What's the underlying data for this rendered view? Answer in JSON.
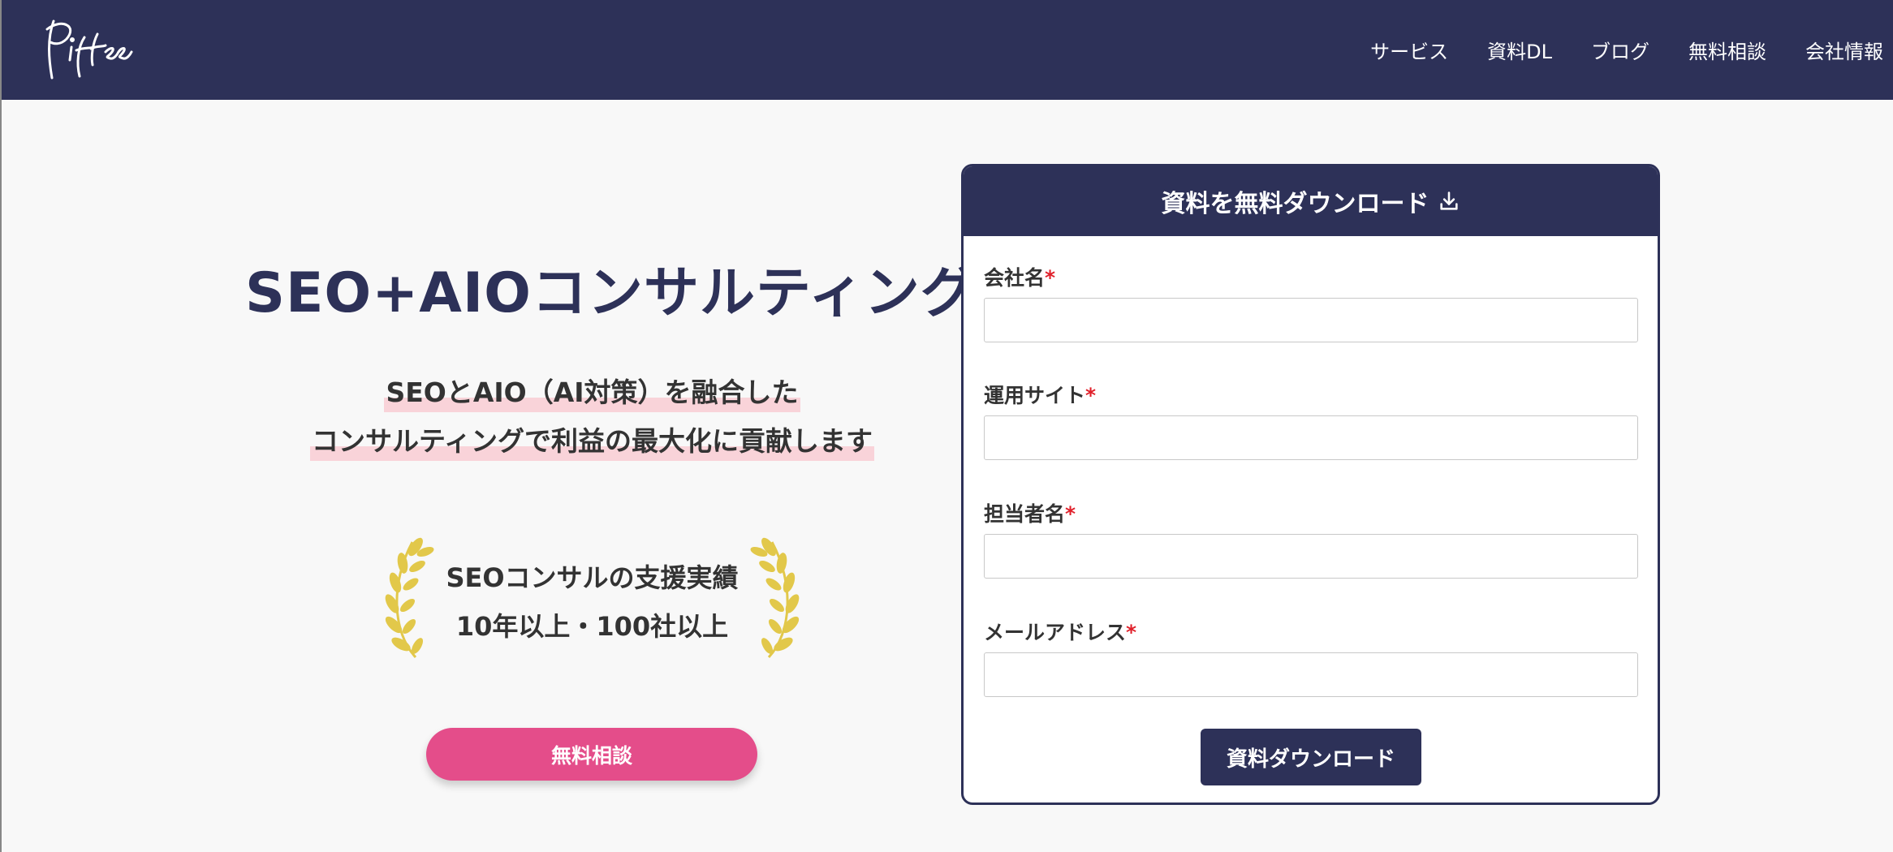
{
  "header": {
    "logo_text": "Piftee",
    "nav": [
      "サービス",
      "資料DL",
      "ブログ",
      "無料相談",
      "会社情報"
    ]
  },
  "hero": {
    "title": "SEO+AIOコンサルティング",
    "lead_lines": [
      "SEOとAIO（AI対策）を融合した",
      "コンサルティングで利益の最大化に貢献します"
    ],
    "award_lines": [
      "SEOコンサルの支援実績",
      "10年以上・100社以上"
    ],
    "cta_label": "無料相談"
  },
  "form": {
    "title": "資料を無料ダウンロード",
    "required_mark": "*",
    "fields": [
      {
        "label": "会社名",
        "value": ""
      },
      {
        "label": "運用サイト",
        "value": ""
      },
      {
        "label": "担当者名",
        "value": ""
      },
      {
        "label": "メールアドレス",
        "value": ""
      }
    ],
    "submit_label": "資料ダウンロード"
  },
  "colors": {
    "navy": "#2d3158",
    "pink": "#e44d8a",
    "highlight": "#f9d3d9",
    "laurel": "#e2c84a",
    "required": "#e0202a"
  }
}
